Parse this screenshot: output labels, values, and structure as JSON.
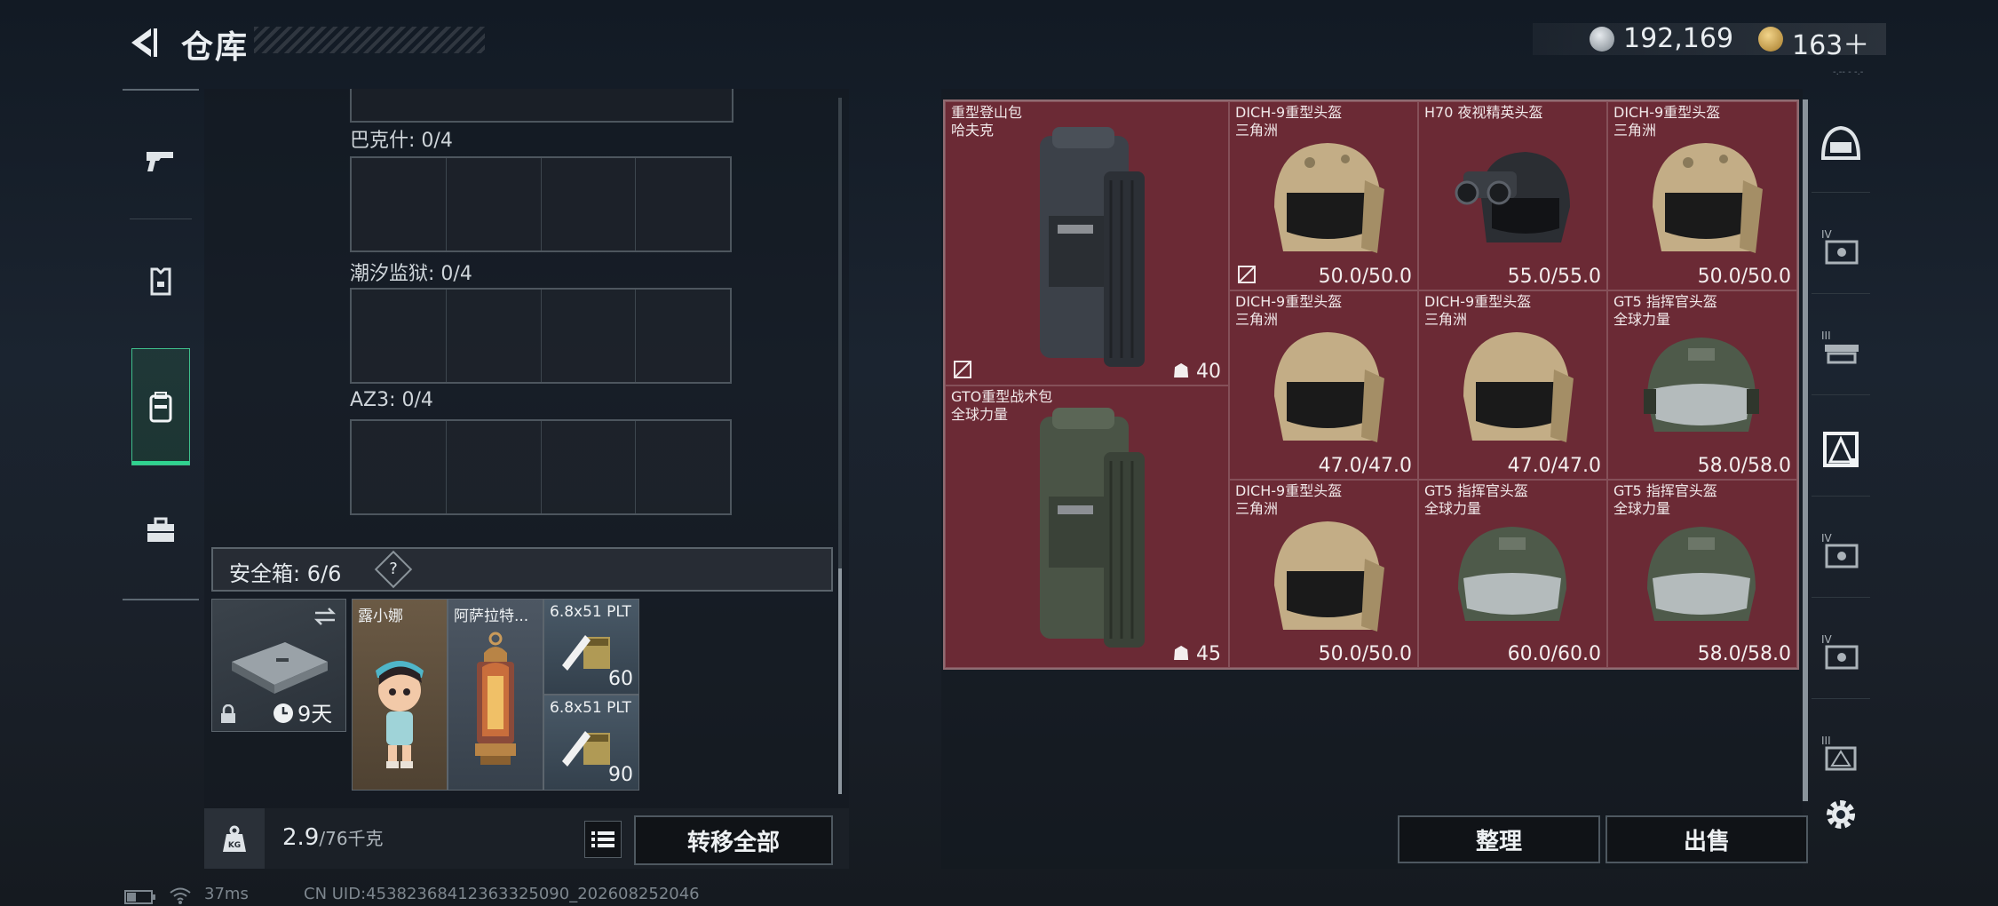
{
  "header": {
    "title": "仓库",
    "currency_primary": "192,169",
    "currency_secondary": "163＋",
    "currency_plus_icon": "plus",
    "version_tiny": "-.-- - -.-"
  },
  "left_tabs": [
    "pistol-icon",
    "armor-icon",
    "backpack-icon",
    "toolbox-icon"
  ],
  "storage_groups": [
    {
      "label": "巴克什: 0/4"
    },
    {
      "label": "潮汐监狱: 0/4"
    },
    {
      "label": "AZ3: 0/4"
    }
  ],
  "safebox": {
    "label": "安全箱: 6/6",
    "help": "?",
    "case_timer": "9天",
    "slots": [
      {
        "label": "露小娜",
        "count": ""
      },
      {
        "label": "阿萨拉特...",
        "count": ""
      },
      {
        "label": "6.8x51\nPLT",
        "count": "60"
      },
      {
        "label": "6.8x51\nPLT",
        "count": "90"
      }
    ]
  },
  "weight": {
    "current": "2.9",
    "max": "/76千克",
    "kg_label": "KG"
  },
  "buttons": {
    "transfer_all": "转移全部",
    "sort": "整理",
    "sell": "出售"
  },
  "items": [
    {
      "name": "重型登山包\n哈夫克",
      "stat": "40",
      "kind": "backpack",
      "color": "#3c4149"
    },
    {
      "name": "DICH-9重型头盔\n三角洲",
      "stat": "50.0/50.0",
      "kind": "helmet-tan"
    },
    {
      "name": "H70 夜视精英头盔",
      "stat": "55.0/55.0",
      "kind": "helmet-nv"
    },
    {
      "name": "DICH-9重型头盔\n三角洲",
      "stat": "50.0/50.0",
      "kind": "helmet-tan"
    },
    {
      "name": "DICH-9重型头盔\n三角洲",
      "stat": "47.0/47.0",
      "kind": "helmet-tan"
    },
    {
      "name": "DICH-9重型头盔\n三角洲",
      "stat": "47.0/47.0",
      "kind": "helmet-tan"
    },
    {
      "name": "GT5 指挥官头盔\n全球力量",
      "stat": "58.0/58.0",
      "kind": "helmet-green"
    },
    {
      "name": "GTO重型战术包\n全球力量",
      "stat": "45",
      "kind": "backpack",
      "color": "#4a5446"
    },
    {
      "name": "DICH-9重型头盔\n三角洲",
      "stat": "50.0/50.0",
      "kind": "helmet-tan"
    },
    {
      "name": "GT5 指挥官头盔\n全球力量",
      "stat": "60.0/60.0",
      "kind": "helmet-green"
    },
    {
      "name": "GT5 指挥官头盔\n全球力量",
      "stat": "58.0/58.0",
      "kind": "helmet-green"
    }
  ],
  "right_tabs": [
    "helmet-slot-icon",
    "armor-tier-iv-icon",
    "rig-tier-iii-icon",
    "backpack-tier-icon",
    "armor-tier-iv-icon",
    "armor-tier-iv-icon",
    "backpack-tier-iii-icon"
  ],
  "status_bar": {
    "ping": "37ms",
    "uid": "CN UID:45382368412363325090_202608252046"
  }
}
